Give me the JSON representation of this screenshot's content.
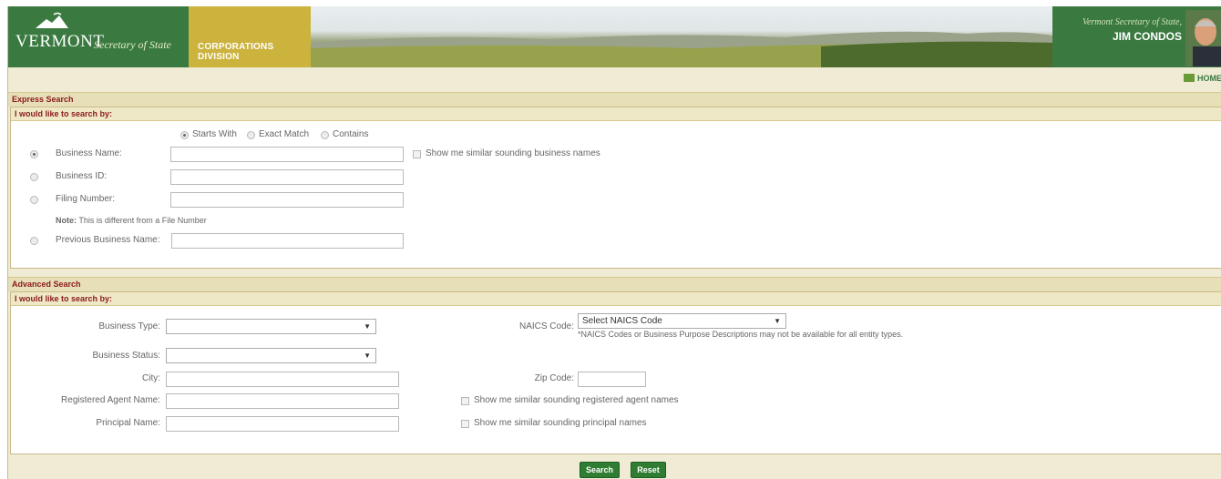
{
  "header": {
    "state": "VERMONT",
    "office": "Secretary of State",
    "division": "CORPORATIONS DIVISION",
    "official_role": "Vermont Secretary of State,",
    "official_name": "JIM CONDOS"
  },
  "nav": {
    "home_label": "HOME"
  },
  "express": {
    "title": "Express Search",
    "subtitle": "I would like to search by:",
    "match_options": [
      "Starts With",
      "Exact Match",
      "Contains"
    ],
    "selected_match": "Starts With",
    "fields": [
      {
        "label": "Business Name:",
        "value": "",
        "selected": true
      },
      {
        "label": "Business ID:",
        "value": "",
        "selected": false
      },
      {
        "label": "Filing Number:",
        "value": "",
        "selected": false
      },
      {
        "label": "Previous Business Name:",
        "value": "",
        "selected": false
      }
    ],
    "note_bold": "Note:",
    "note_text": "This is different from a File Number",
    "similar_label": "Show me similar sounding business names"
  },
  "advanced": {
    "title": "Advanced Search",
    "subtitle": "I would like to search by:",
    "business_type_label": "Business Type:",
    "business_type_value": "",
    "business_status_label": "Business Status:",
    "business_status_value": "",
    "city_label": "City:",
    "city_value": "",
    "agent_label": "Registered Agent Name:",
    "agent_value": "",
    "principal_label": "Principal Name:",
    "principal_value": "",
    "naics_label": "NAICS Code:",
    "naics_value": "Select NAICS Code",
    "naics_note": "*NAICS Codes or Business Purpose Descriptions may not be available for all entity types.",
    "zip_label": "Zip Code:",
    "zip_value": "",
    "similar_agent_label": "Show me similar sounding registered agent names",
    "similar_principal_label": "Show me similar sounding principal names"
  },
  "actions": {
    "search_label": "Search",
    "reset_label": "Reset"
  },
  "colors": {
    "brand_green": "#3a7a40",
    "division_gold": "#cbb33e",
    "section_red": "#8b1a1a",
    "button_green": "#2e7d32"
  }
}
